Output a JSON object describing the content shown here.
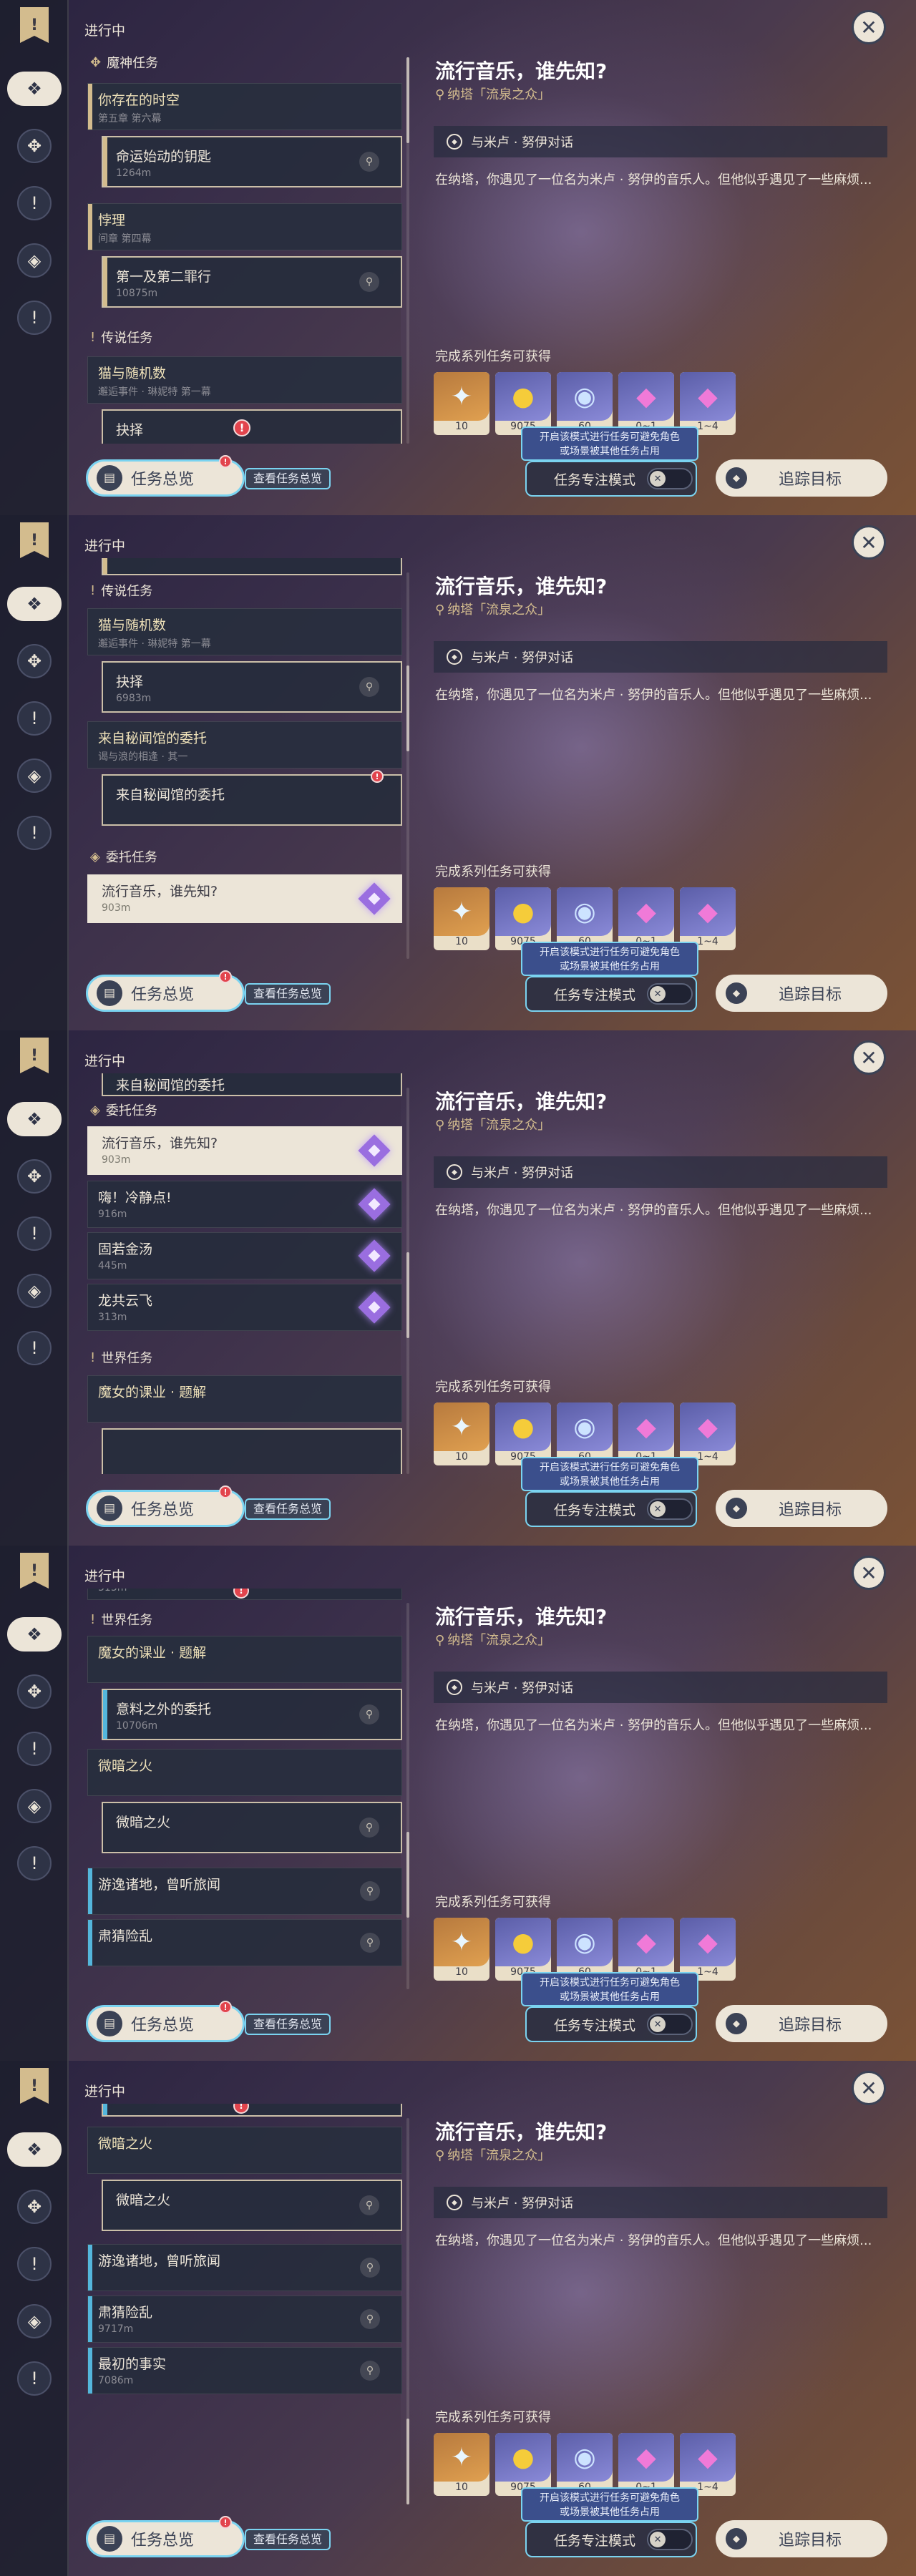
{
  "labels": {
    "status": "进行中",
    "overview": "任务总览",
    "view_overview": "查看任务总览",
    "focus_mode": "任务专注模式",
    "tooltip_line1": "开启该模式进行任务可避免角色",
    "tooltip_line2": "或场景被其他任务占用",
    "track": "追踪目标",
    "rewards_label": "完成系列任务可获得",
    "alert_mark": "!"
  },
  "sections": {
    "archon": "魔神任务",
    "legend": "传说任务",
    "commission": "委托任务",
    "world": "世界任务"
  },
  "quests": {
    "q1": {
      "title": "你存在的时空",
      "sub": "第五章 第六幕"
    },
    "q1a": {
      "title": "命运始动的钥匙",
      "sub": "1264m"
    },
    "q2": {
      "title": "悖理",
      "sub": "间章 第四幕"
    },
    "q2a": {
      "title": "第一及第二罪行",
      "sub": "10875m"
    },
    "q3": {
      "title": "猫与随机数",
      "sub": "邂逅事件 · 琳妮特 第一幕"
    },
    "q3a": {
      "title": "抉择",
      "sub": "6983m"
    },
    "q4": {
      "title": "来自秘闻馆的委托",
      "sub": "谒与浪的相逢 · 其一"
    },
    "q4a": {
      "title": "来自秘闻馆的委托",
      "sub": ""
    },
    "c1": {
      "title": "流行音乐，谁先知?",
      "sub": "903m"
    },
    "c2": {
      "title": "嗨！冷静点!",
      "sub": "916m"
    },
    "c3": {
      "title": "固若金汤",
      "sub": "445m"
    },
    "c4": {
      "title": "龙共云飞",
      "sub": "313m"
    },
    "w1": {
      "title": "魔女的课业 · 题解",
      "sub": ""
    },
    "w1a": {
      "title": "意料之外的委托",
      "sub": "10706m"
    },
    "w2": {
      "title": "微暗之火",
      "sub": ""
    },
    "w2a": {
      "title": "微暗之火",
      "sub": ""
    },
    "w3": {
      "title": "游逸诸地，曾听旅闻",
      "sub": ""
    },
    "w4": {
      "title": "肃猜险乱",
      "sub": "9717m"
    },
    "w5": {
      "title": "最初的事实",
      "sub": "7086m"
    },
    "clip1": {
      "sub": "10875m"
    },
    "clip2": {
      "title": "来自秘闻馆的委托"
    },
    "clip3": {
      "sub": "313m"
    },
    "clip4": {
      "sub": "10706m"
    }
  },
  "detail": {
    "title": "流行音乐，谁先知?",
    "location": "纳塔「流泉之众」",
    "objective": "与米卢 · 努伊对话",
    "description": "在纳塔，你遇见了一位名为米卢 · 努伊的音乐人。但他似乎遇见了一些麻烦..."
  },
  "rewards": [
    {
      "icon": "intertwined-fate",
      "glyph": "✦",
      "count": "10"
    },
    {
      "icon": "mora",
      "glyph": "●",
      "count": "9075"
    },
    {
      "icon": "adventure-exp",
      "glyph": "◉",
      "count": "60"
    },
    {
      "icon": "crystal-chunk",
      "glyph": "◆",
      "count": "0~1"
    },
    {
      "icon": "crystal-cluster",
      "glyph": "◆",
      "count": "1~4"
    }
  ],
  "colors": {
    "gold_accent": "#d3bc8e",
    "blue_accent": "#54b6dc",
    "highlight_border": "#7ad3f0",
    "alert_red": "#e2444d",
    "panel_cream": "#ece5d8"
  },
  "scroll_positions": [
    0,
    0.3,
    0.55,
    0.78,
    1.0
  ]
}
